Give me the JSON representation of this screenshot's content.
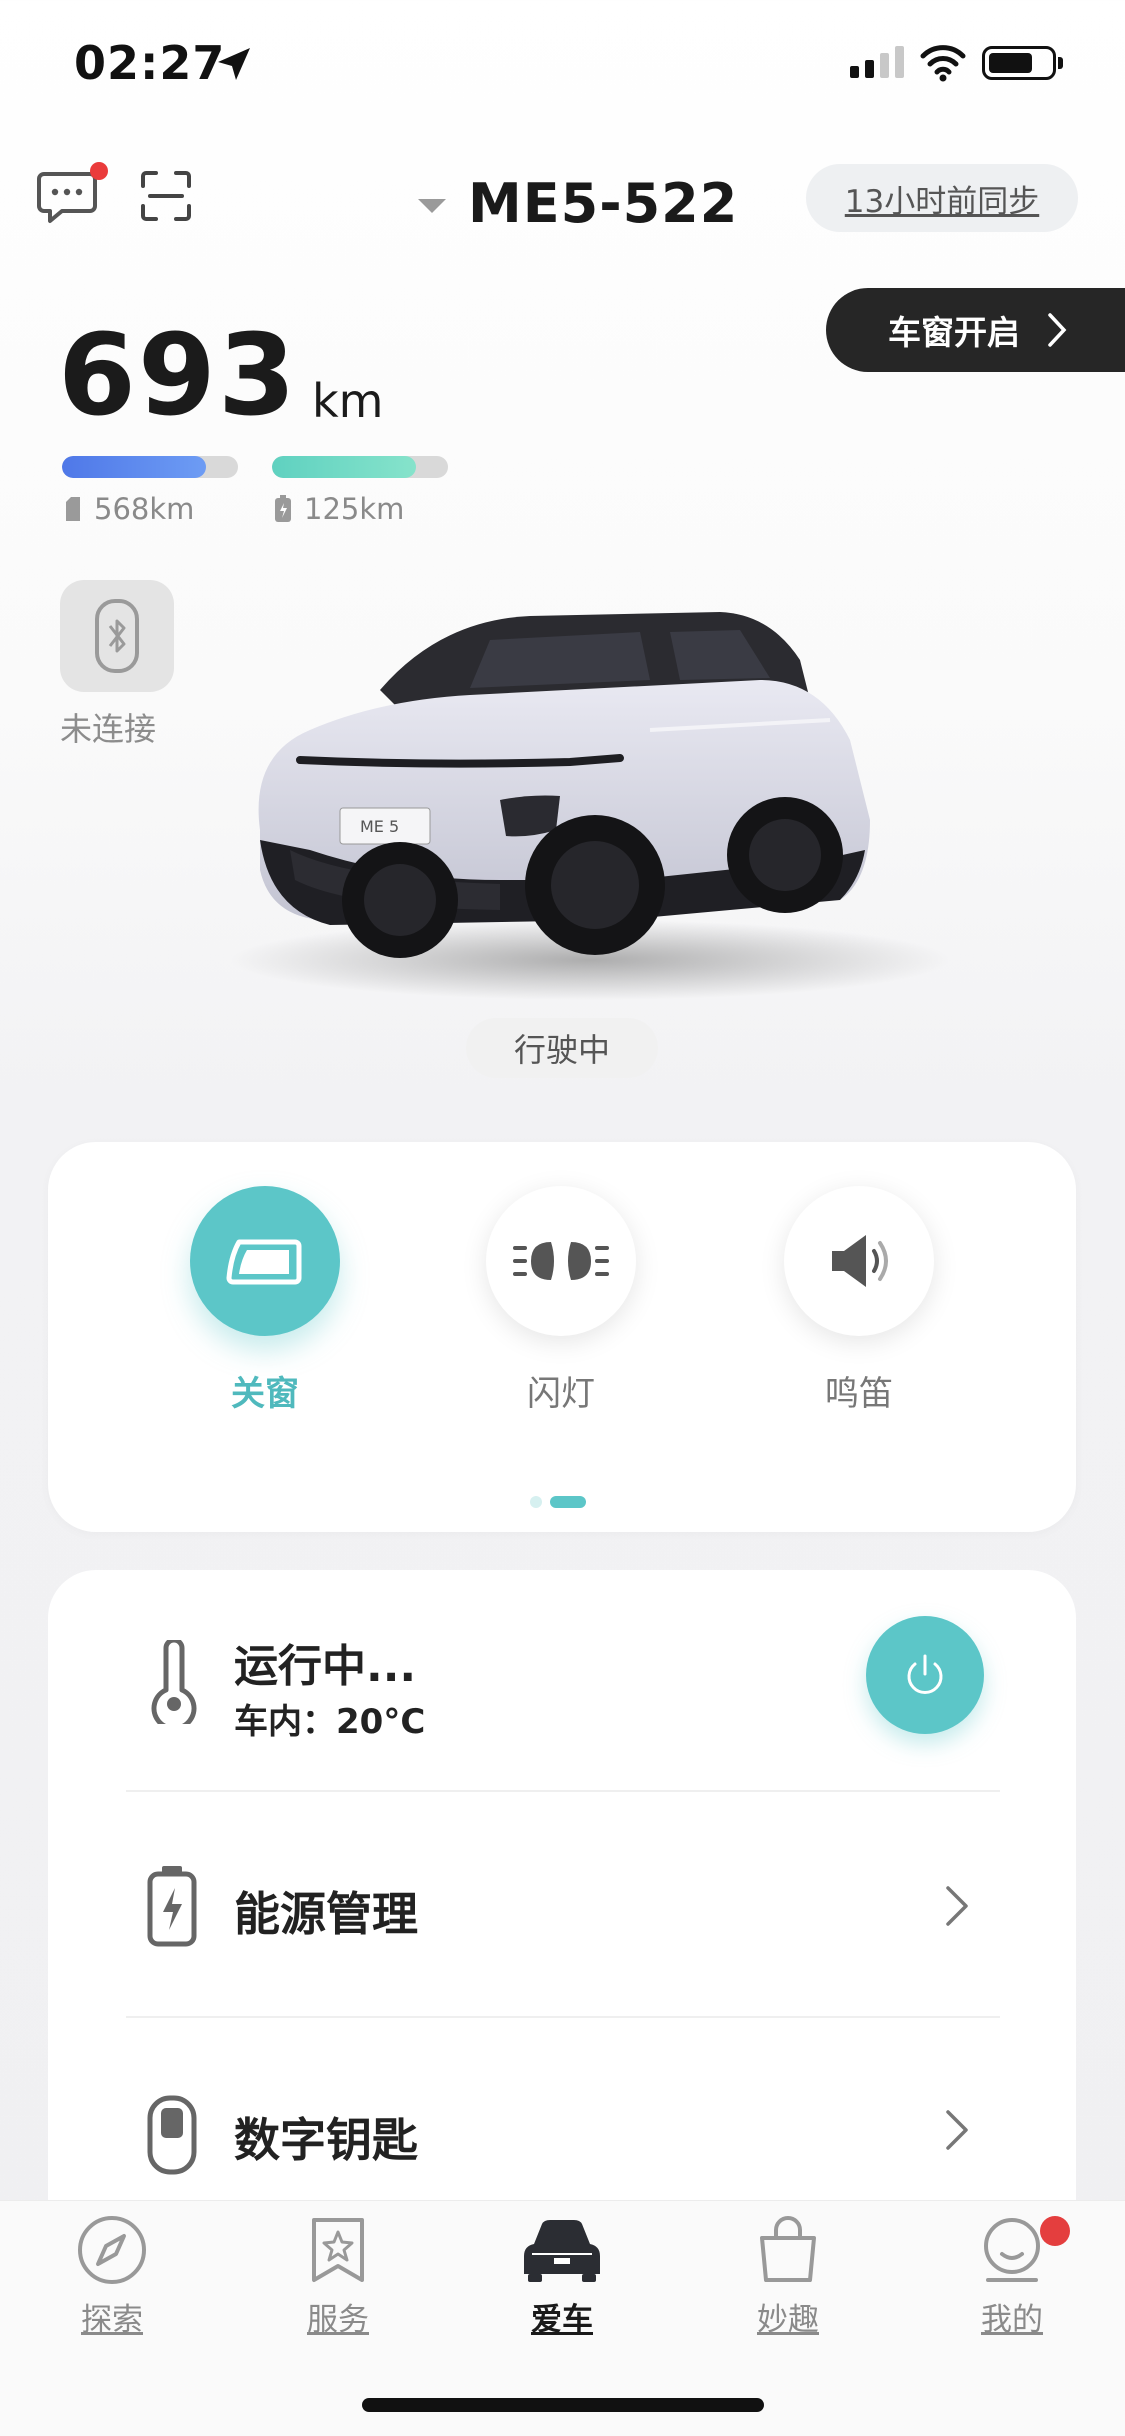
{
  "status_bar": {
    "time": "02:27"
  },
  "header": {
    "car_name": "ME5-522",
    "sync_label": "13小时前同步",
    "icons": [
      "message-icon",
      "scan-icon"
    ]
  },
  "window_status": {
    "label": "车窗开启"
  },
  "range": {
    "total": "693",
    "unit": "km",
    "fuel": {
      "label": "568km",
      "level": 0.82
    },
    "electric": {
      "label": "125km",
      "level": 0.82
    }
  },
  "bluetooth": {
    "label": "未连接"
  },
  "car_status": "行驶中",
  "quick_actions": [
    {
      "label": "关窗",
      "icon": "window-close-icon",
      "active": true
    },
    {
      "label": "闪灯",
      "icon": "flash-lights-icon",
      "active": false
    },
    {
      "label": "鸣笛",
      "icon": "horn-icon",
      "active": false
    }
  ],
  "climate": {
    "title": "运行中...",
    "subtitle": "车内：20°C"
  },
  "menu_rows": [
    {
      "label": "能源管理",
      "icon": "battery-charge-icon"
    },
    {
      "label": "数字钥匙",
      "icon": "digital-key-icon"
    }
  ],
  "tabs": [
    {
      "label": "探索",
      "icon": "compass-icon"
    },
    {
      "label": "服务",
      "icon": "service-star-icon"
    },
    {
      "label": "爱车",
      "icon": "car-icon",
      "active": true
    },
    {
      "label": "妙趣",
      "icon": "shopping-bag-icon"
    },
    {
      "label": "我的",
      "icon": "profile-icon"
    }
  ],
  "colors": {
    "accent": "#5cc6c8",
    "fuel_bar": "#4f78e8",
    "electric_bar": "#5fd1c0",
    "badge_red": "#ea3b3b"
  }
}
